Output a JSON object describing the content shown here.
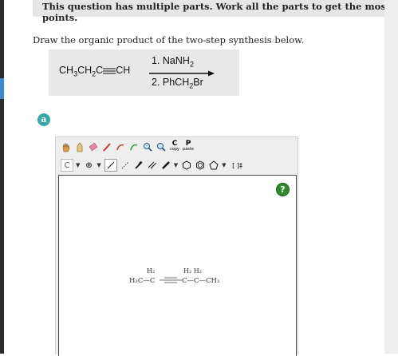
{
  "header": {
    "text": "This question has multiple parts. Work all the parts to get the most points."
  },
  "instruction": "Draw the organic product of the two-step synthesis below.",
  "reaction": {
    "reactant": {
      "a": "CH",
      "s1": "3",
      "b": "CH",
      "s2": "2",
      "c": "C",
      "d": "CH"
    },
    "step1": {
      "a": "1. NaNH",
      "s": "2"
    },
    "step2": {
      "a": "2. PhCH",
      "s": "2",
      "b": "Br"
    }
  },
  "part": {
    "label": "a"
  },
  "toolbar": {
    "element": "C",
    "charge": "⊕",
    "bracket": "[ ]‡",
    "copy_label": "C",
    "copy_sub": "copy",
    "paste_label": "P",
    "paste_sub": "paste"
  },
  "help": {
    "label": "?"
  },
  "molecule": {
    "left_h": "H₂",
    "left": "H₃C—C",
    "right_h": "H₂ H₂",
    "right": "C—C—CH₃"
  }
}
